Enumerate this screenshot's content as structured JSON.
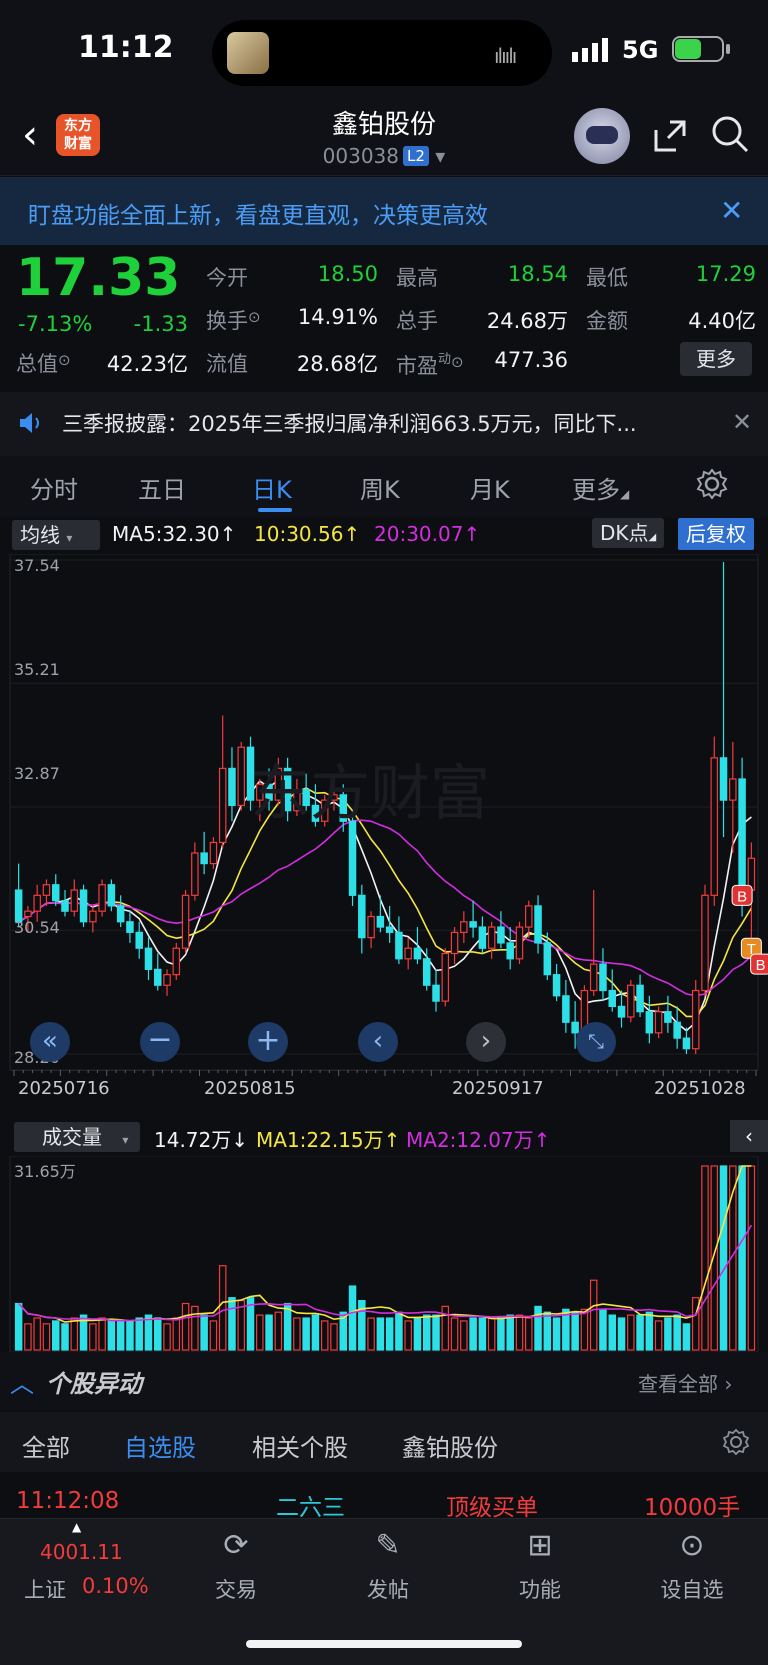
{
  "status": {
    "time": "11:12",
    "network": "5G"
  },
  "header": {
    "app_logo": "东方\n财富",
    "stock_name": "鑫铂股份",
    "stock_code": "003038",
    "level": "L2"
  },
  "banner": {
    "text": "盯盘功能全面上新，看盘更直观，决策更高效",
    "close": "✕"
  },
  "quote": {
    "price": "17.33",
    "change_pct": "-7.13%",
    "change": "-1.33",
    "fields": [
      {
        "label": "今开",
        "value": "18.50",
        "color": "green"
      },
      {
        "label": "最高",
        "value": "18.54",
        "color": "green"
      },
      {
        "label": "最低",
        "value": "17.29",
        "color": "green"
      },
      {
        "label": "换手",
        "value": "14.91%",
        "color": "white"
      },
      {
        "label": "总手",
        "value": "24.68万",
        "color": "white"
      },
      {
        "label": "金额",
        "value": "4.40亿",
        "color": "white"
      },
      {
        "label": "总值",
        "value": "42.23亿",
        "color": "white"
      },
      {
        "label": "流值",
        "value": "28.68亿",
        "color": "white"
      },
      {
        "label": "市盈",
        "value": "477.36",
        "color": "white"
      }
    ],
    "pe_super": "动",
    "more": "更多"
  },
  "news": {
    "text": "三季报披露：2025年三季报归属净利润663.5万元，同比下..."
  },
  "tabs": [
    "分时",
    "五日",
    "日K",
    "周K",
    "月K",
    "更多"
  ],
  "active_tab": "日K",
  "kline": {
    "indicator": "均线",
    "ma5": "MA5:32.30",
    "ma10": "10:30.56",
    "ma20": "20:30.07",
    "dk": "DK点",
    "adjust": "后复权",
    "y_labels": [
      "37.54",
      "35.21",
      "32.87",
      "30.54",
      "28.20"
    ],
    "dates": [
      "20250716",
      "20250815",
      "20250917",
      "20251028"
    ],
    "markers": {
      "b": "B",
      "t": "T"
    }
  },
  "volume": {
    "indicator": "成交量",
    "vol": "14.72万",
    "ma1": "MA1:22.15万",
    "ma2": "MA2:12.07万",
    "max_label": "31.65万"
  },
  "abnormal": {
    "title": "个股异动",
    "view_all": "查看全部",
    "tabs": [
      "全部",
      "自选股",
      "相关个股",
      "鑫铂股份"
    ],
    "active_tab": "自选股",
    "row": {
      "time": "11:12:08",
      "name": "二六三",
      "type": "顶级买单",
      "qty": "10000手"
    }
  },
  "bottom_nav": {
    "index_value": "4001.11",
    "index_name": "上证",
    "index_pct": "0.10%",
    "items": [
      "交易",
      "发帖",
      "功能",
      "设自选"
    ]
  },
  "chart_data": {
    "type": "candlestick",
    "ylim": [
      28.2,
      37.54
    ],
    "x_ticks": [
      "20250716",
      "20250815",
      "20250917",
      "20251028"
    ],
    "y_ticks": [
      37.54,
      35.21,
      32.87,
      30.54,
      28.2
    ],
    "series": [
      {
        "name": "MA5",
        "last": 32.3
      },
      {
        "name": "10",
        "last": 30.56
      },
      {
        "name": "20",
        "last": 30.07
      }
    ],
    "candles": [
      [
        31.3,
        31.8,
        30.6,
        30.7
      ],
      [
        30.8,
        31.0,
        30.5,
        30.9
      ],
      [
        30.9,
        31.4,
        30.7,
        31.2
      ],
      [
        31.2,
        31.5,
        31.0,
        31.4
      ],
      [
        31.4,
        31.6,
        31.0,
        31.1
      ],
      [
        31.1,
        31.3,
        30.8,
        30.9
      ],
      [
        30.9,
        31.5,
        30.8,
        31.3
      ],
      [
        31.3,
        31.4,
        30.6,
        30.7
      ],
      [
        30.7,
        31.0,
        30.5,
        30.9
      ],
      [
        30.9,
        31.5,
        30.8,
        31.4
      ],
      [
        31.4,
        31.5,
        30.9,
        31.0
      ],
      [
        31.0,
        31.2,
        30.6,
        30.7
      ],
      [
        30.7,
        30.9,
        30.3,
        30.5
      ],
      [
        30.5,
        30.7,
        30.0,
        30.2
      ],
      [
        30.2,
        30.4,
        29.6,
        29.8
      ],
      [
        29.8,
        30.1,
        29.4,
        29.5
      ],
      [
        29.5,
        29.8,
        29.3,
        29.7
      ],
      [
        29.7,
        30.3,
        29.6,
        30.2
      ],
      [
        30.2,
        31.3,
        30.1,
        31.2
      ],
      [
        31.2,
        32.2,
        31.1,
        32.0
      ],
      [
        32.0,
        32.4,
        31.6,
        31.8
      ],
      [
        31.8,
        32.3,
        31.7,
        32.2
      ],
      [
        32.2,
        34.6,
        32.1,
        33.6
      ],
      [
        33.6,
        34.0,
        32.6,
        32.9
      ],
      [
        32.9,
        34.1,
        32.8,
        34.0
      ],
      [
        34.0,
        34.2,
        32.8,
        33.0
      ],
      [
        33.0,
        33.4,
        32.6,
        33.3
      ],
      [
        33.3,
        33.6,
        32.8,
        33.0
      ],
      [
        33.0,
        33.8,
        32.9,
        33.6
      ],
      [
        33.6,
        33.8,
        32.6,
        32.8
      ],
      [
        32.8,
        33.4,
        32.7,
        33.2
      ],
      [
        33.2,
        33.5,
        32.8,
        32.9
      ],
      [
        32.9,
        33.3,
        32.5,
        32.6
      ],
      [
        32.6,
        33.1,
        32.5,
        33.0
      ],
      [
        33.0,
        33.3,
        32.8,
        33.1
      ],
      [
        33.1,
        33.3,
        32.4,
        32.6
      ],
      [
        32.6,
        32.8,
        31.0,
        31.2
      ],
      [
        31.2,
        31.4,
        30.1,
        30.4
      ],
      [
        30.4,
        30.9,
        30.2,
        30.8
      ],
      [
        30.8,
        31.2,
        30.5,
        30.6
      ],
      [
        30.6,
        31.0,
        30.3,
        30.5
      ],
      [
        30.5,
        30.8,
        29.9,
        30.0
      ],
      [
        30.0,
        30.4,
        29.8,
        30.2
      ],
      [
        30.2,
        30.6,
        29.9,
        30.0
      ],
      [
        30.0,
        30.2,
        29.4,
        29.5
      ],
      [
        29.5,
        29.8,
        29.0,
        29.2
      ],
      [
        29.2,
        30.2,
        29.1,
        30.1
      ],
      [
        30.1,
        30.6,
        29.9,
        30.5
      ],
      [
        30.5,
        30.9,
        30.3,
        30.7
      ],
      [
        30.7,
        31.1,
        30.4,
        30.6
      ],
      [
        30.6,
        30.8,
        30.1,
        30.2
      ],
      [
        30.2,
        30.7,
        30.0,
        30.6
      ],
      [
        30.6,
        30.9,
        30.2,
        30.3
      ],
      [
        30.3,
        30.6,
        29.8,
        30.0
      ],
      [
        30.0,
        30.7,
        29.9,
        30.6
      ],
      [
        30.6,
        31.1,
        30.4,
        31.0
      ],
      [
        31.0,
        31.2,
        30.1,
        30.3
      ],
      [
        30.3,
        30.5,
        29.6,
        29.7
      ],
      [
        29.7,
        29.9,
        29.2,
        29.3
      ],
      [
        29.3,
        29.6,
        28.6,
        28.8
      ],
      [
        28.8,
        29.2,
        28.3,
        28.6
      ],
      [
        28.6,
        29.5,
        28.5,
        29.4
      ],
      [
        29.4,
        31.3,
        29.3,
        29.9
      ],
      [
        29.9,
        30.2,
        29.2,
        29.4
      ],
      [
        29.4,
        29.8,
        29.0,
        29.1
      ],
      [
        29.1,
        29.4,
        28.7,
        28.9
      ],
      [
        28.9,
        29.6,
        28.8,
        29.5
      ],
      [
        29.5,
        29.7,
        28.9,
        29.0
      ],
      [
        29.0,
        29.3,
        28.4,
        28.6
      ],
      [
        28.6,
        29.1,
        28.5,
        29.0
      ],
      [
        29.0,
        29.3,
        28.6,
        28.8
      ],
      [
        28.8,
        29.1,
        28.3,
        28.5
      ],
      [
        28.5,
        28.7,
        28.2,
        28.3
      ],
      [
        28.3,
        29.6,
        28.2,
        29.4
      ],
      [
        29.4,
        31.4,
        29.3,
        31.2
      ],
      [
        31.2,
        34.2,
        31.0,
        33.8
      ],
      [
        33.8,
        37.5,
        32.3,
        33.0
      ],
      [
        33.0,
        34.1,
        32.0,
        33.4
      ],
      [
        33.4,
        33.8,
        30.8,
        31.3
      ],
      [
        31.3,
        32.2,
        30.4,
        31.9
      ]
    ]
  }
}
